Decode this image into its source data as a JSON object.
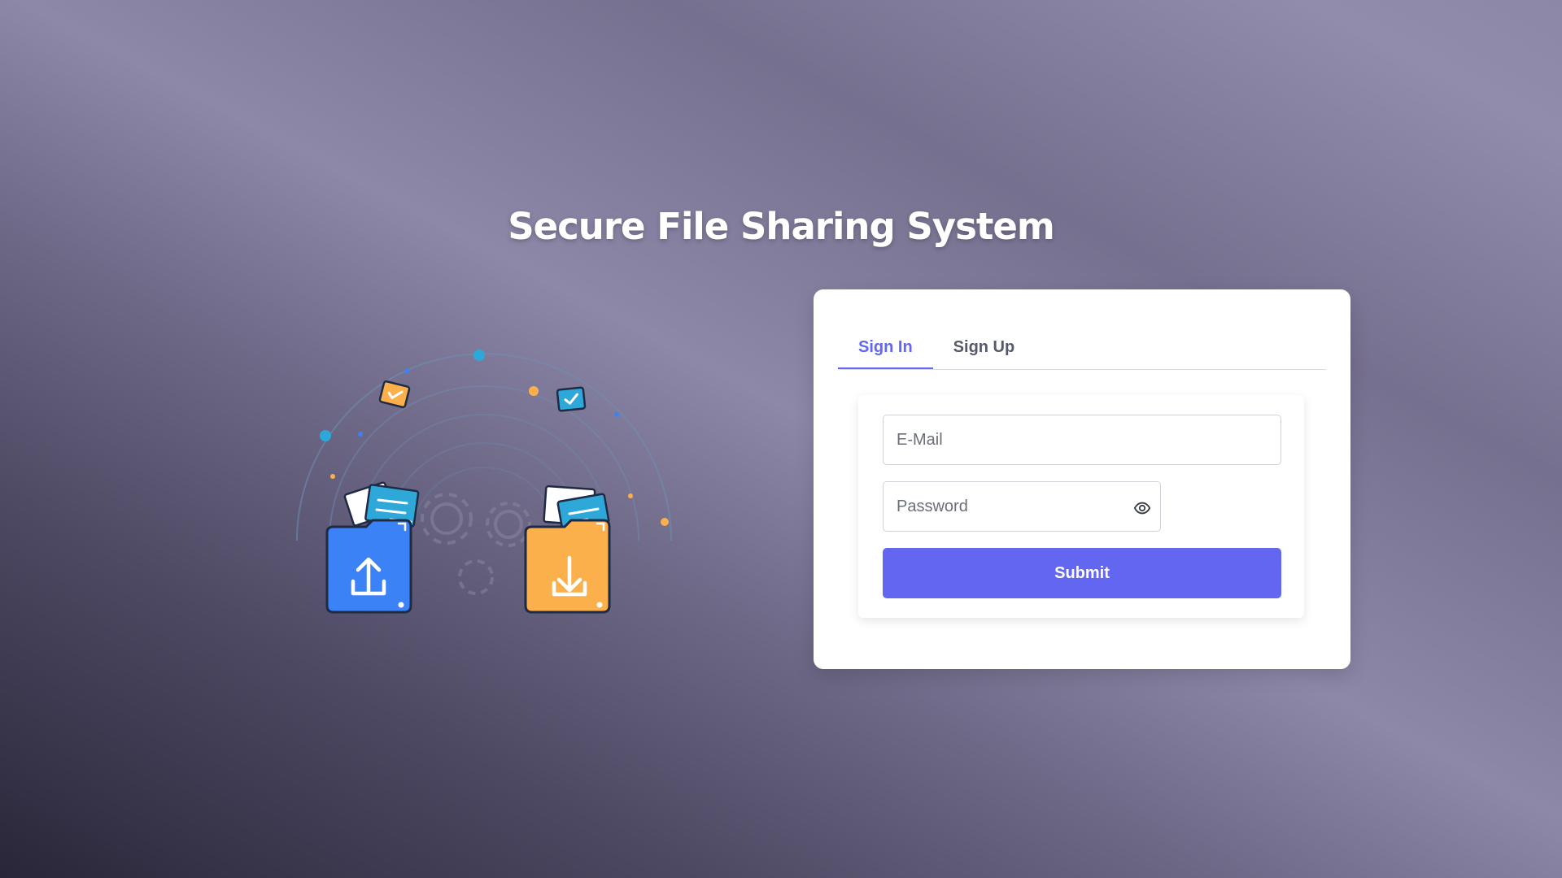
{
  "app": {
    "title": "Secure File Sharing System"
  },
  "auth": {
    "tabs": [
      {
        "label": "Sign In",
        "active": true
      },
      {
        "label": "Sign Up",
        "active": false
      }
    ],
    "email": {
      "placeholder": "E-Mail",
      "value": ""
    },
    "password": {
      "placeholder": "Password",
      "value": ""
    },
    "submit_label": "Submit"
  },
  "illustration": {
    "upload_folder_icon": "upload-folder-icon",
    "download_folder_icon": "download-folder-icon"
  },
  "colors": {
    "accent": "#6366f1",
    "upload_folder": "#3b82f6",
    "download_folder": "#fbb04c",
    "cyan": "#2aa8d8"
  }
}
